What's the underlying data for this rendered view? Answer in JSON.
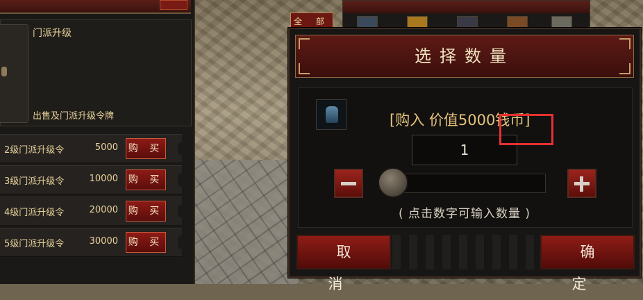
{
  "shop": {
    "title": "门派升级",
    "description": "出售及门派升级令牌",
    "buy_label": "购 买",
    "items": [
      {
        "name": "2级门派升级令",
        "price": "5000"
      },
      {
        "name": "3级门派升级令",
        "price": "10000"
      },
      {
        "name": "4级门派升级令",
        "price": "20000"
      },
      {
        "name": "5级门派升级令",
        "price": "30000"
      }
    ]
  },
  "background_window": {
    "tab_label": "全 部"
  },
  "dialog": {
    "title": "选择数量",
    "price_text": "[购入 价值5000钱币]",
    "quantity": "1",
    "slider_fraction": 0,
    "hint": "( 点击数字可输入数量 )",
    "cancel_label": "取 消",
    "confirm_label": "确 定",
    "item_icon": "cloak-icon"
  },
  "colors": {
    "accent_red": "#8c1a16",
    "gold_text": "#e6c37c",
    "highlight": "#e53030"
  }
}
